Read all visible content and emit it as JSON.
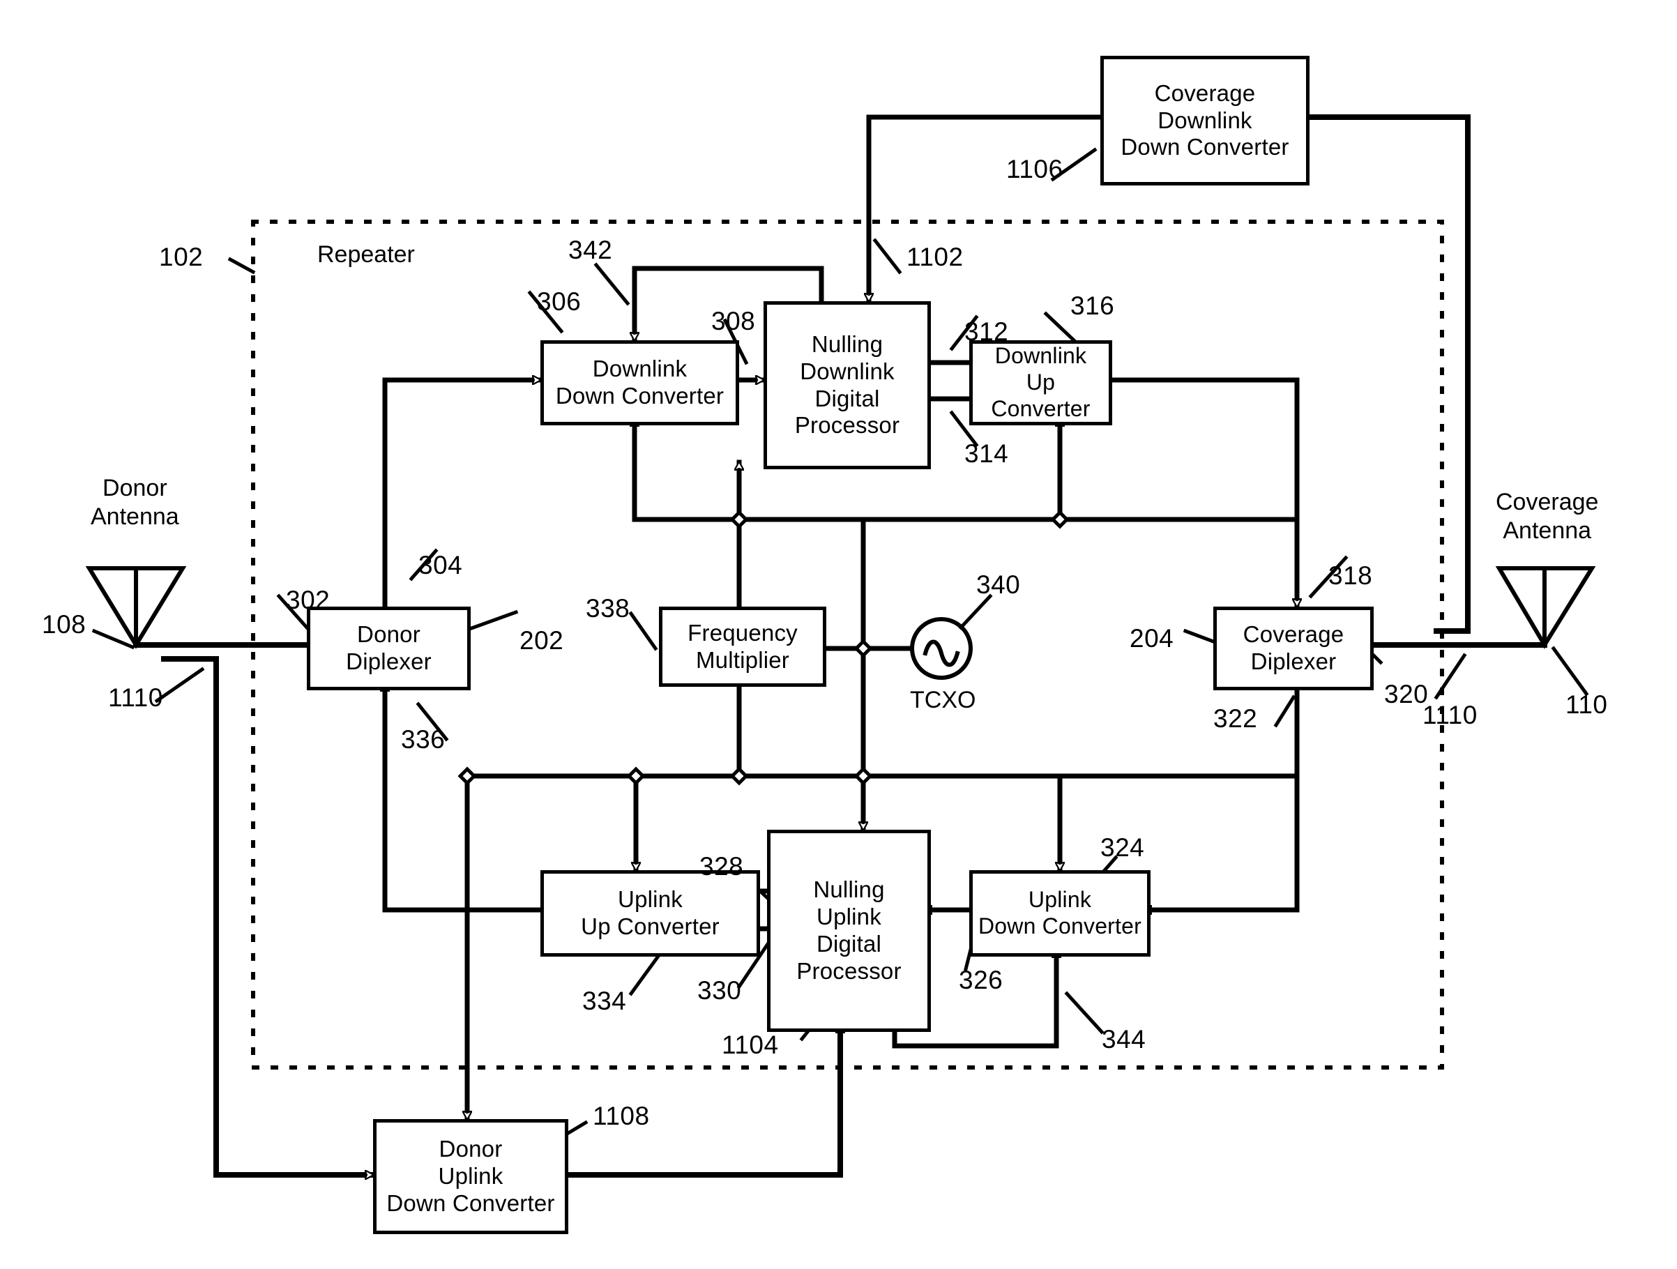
{
  "figure": {
    "title_text": "Repeater",
    "line_color": "#000000",
    "background": "#ffffff"
  },
  "blocks": {
    "coverage_downlink_down_converter": "Coverage\nDownlink\nDown Converter",
    "downlink_down_converter": "Downlink\nDown Converter",
    "nulling_downlink_digital_processor": "Nulling\nDownlink\nDigital\nProcessor",
    "downlink_up_converter": "Downlink\nUp Converter",
    "donor_diplexer": "Donor\nDiplexer",
    "frequency_multiplier": "Frequency\nMultiplier",
    "coverage_diplexer": "Coverage\nDiplexer",
    "uplink_up_converter": "Uplink\nUp Converter",
    "nulling_uplink_digital_processor": "Nulling\nUplink\nDigital\nProcessor",
    "uplink_down_converter": "Uplink\nDown Converter",
    "donor_uplink_down_converter": "Donor\nUplink\nDown Converter"
  },
  "labels": {
    "repeater": "Repeater",
    "donor_antenna": "Donor\nAntenna",
    "coverage_antenna": "Coverage\nAntenna",
    "tcxo": "TCXO"
  },
  "reference_numerals": {
    "n102": "102",
    "n108": "108",
    "n110": "110",
    "n202": "202",
    "n204": "204",
    "n302": "302",
    "n304": "304",
    "n306": "306",
    "n308": "308",
    "n312": "312",
    "n314": "314",
    "n316": "316",
    "n318": "318",
    "n320": "320",
    "n322": "322",
    "n324": "324",
    "n326": "326",
    "n328": "328",
    "n330": "330",
    "n334": "334",
    "n336": "336",
    "n338": "338",
    "n340": "340",
    "n342": "342",
    "n344": "344",
    "n1102": "1102",
    "n1104": "1104",
    "n1106": "1106",
    "n1108": "1108",
    "n1110a": "1110",
    "n1110b": "1110"
  }
}
